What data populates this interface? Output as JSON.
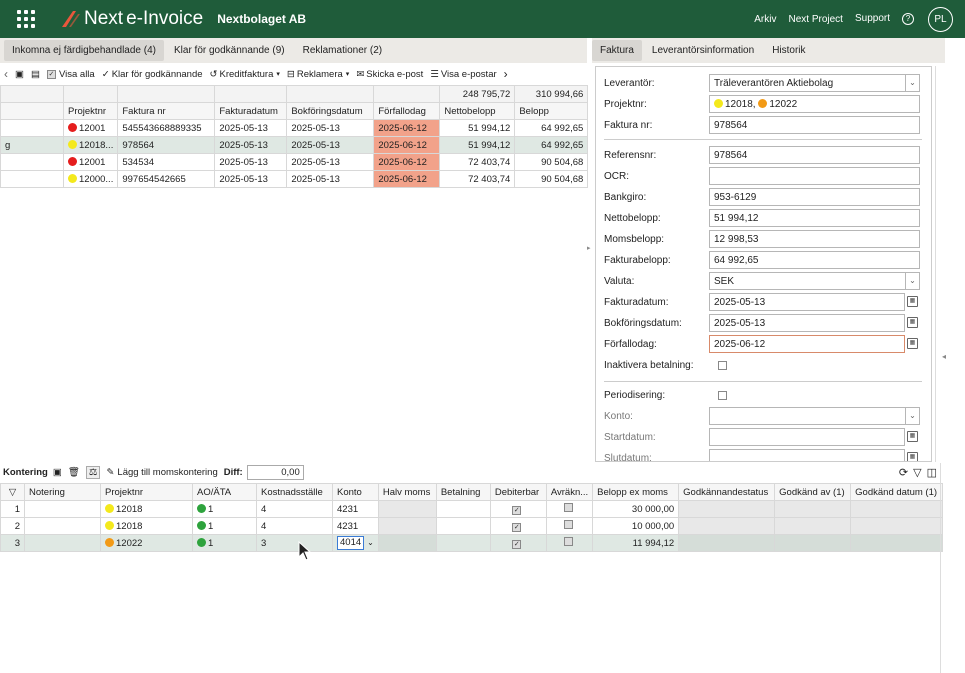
{
  "header": {
    "brand_name": "Next",
    "brand_product": "e-Invoice",
    "company": "Nextbolaget AB",
    "nav": [
      "Arkiv",
      "Next Project",
      "Support"
    ],
    "avatar": "PL"
  },
  "left_tabs": [
    "Inkomna ej färdigbehandlade (4)",
    "Klar för godkännande (9)",
    "Reklamationer (2)"
  ],
  "toolbar": {
    "visa_alla": "Visa alla",
    "klar": "Klar för godkännande",
    "kredit": "Kreditfaktura",
    "reklamera": "Reklamera",
    "skicka": "Skicka e-post",
    "visa_epost": "Visa e-postar"
  },
  "invoice_table": {
    "totals": {
      "netto": "248 795,72",
      "belopp": "310 994,66"
    },
    "columns": [
      "Projektnr",
      "Faktura nr",
      "Fakturadatum",
      "Bokföringsdatum",
      "Förfallodag",
      "Nettobelopp",
      "Belopp"
    ],
    "rows": [
      {
        "lead": "",
        "dot": "red",
        "projekt": "12001",
        "faktura": "545543668889335",
        "fdatum": "2025-05-13",
        "bdatum": "2025-05-13",
        "forfall": "2025-06-12",
        "netto": "51 994,12",
        "belopp": "64 992,65"
      },
      {
        "lead": "g",
        "dot": "yellow",
        "projekt": "12018...",
        "faktura": "978564",
        "fdatum": "2025-05-13",
        "bdatum": "2025-05-13",
        "forfall": "2025-06-12",
        "netto": "51 994,12",
        "belopp": "64 992,65"
      },
      {
        "lead": "",
        "dot": "red",
        "projekt": "12001",
        "faktura": "534534",
        "fdatum": "2025-05-13",
        "bdatum": "2025-05-13",
        "forfall": "2025-06-12",
        "netto": "72 403,74",
        "belopp": "90 504,68"
      },
      {
        "lead": "",
        "dot": "yellow",
        "projekt": "12000...",
        "faktura": "997654542665",
        "fdatum": "2025-05-13",
        "bdatum": "2025-05-13",
        "forfall": "2025-06-12",
        "netto": "72 403,74",
        "belopp": "90 504,68"
      }
    ]
  },
  "right_tabs": [
    "Faktura",
    "Leverantörsinformation",
    "Historik"
  ],
  "form": {
    "leverantor": {
      "label": "Leverantör:",
      "value": "Träleverantören Aktiebolag"
    },
    "projektnr": {
      "label": "Projektnr:",
      "p1": "12018,",
      "p2": "12022"
    },
    "fakturanr": {
      "label": "Faktura nr:",
      "value": "978564"
    },
    "referensnr": {
      "label": "Referensnr:",
      "value": "978564"
    },
    "ocr": {
      "label": "OCR:",
      "value": ""
    },
    "bankgiro": {
      "label": "Bankgiro:",
      "value": "953-6129"
    },
    "netto": {
      "label": "Nettobelopp:",
      "value": "51 994,12"
    },
    "moms": {
      "label": "Momsbelopp:",
      "value": "12 998,53"
    },
    "faktbelopp": {
      "label": "Fakturabelopp:",
      "value": "64 992,65"
    },
    "valuta": {
      "label": "Valuta:",
      "value": "SEK"
    },
    "fakturadatum": {
      "label": "Fakturadatum:",
      "value": "2025-05-13"
    },
    "bokforing": {
      "label": "Bokföringsdatum:",
      "value": "2025-05-13"
    },
    "forfallodag": {
      "label": "Förfallodag:",
      "value": "2025-06-12"
    },
    "inaktivera": {
      "label": "Inaktivera betalning:"
    },
    "periodisering": {
      "label": "Periodisering:"
    },
    "konto": {
      "label": "Konto:"
    },
    "startdatum": {
      "label": "Startdatum:"
    },
    "slutdatum": {
      "label": "Slutdatum:"
    }
  },
  "kontering": {
    "title": "Kontering",
    "add_moms": "Lägg till momskontering",
    "diff_label": "Diff:",
    "diff_value": "0,00",
    "columns": [
      "Notering",
      "Projektnr",
      "AO/ÄTA",
      "Kostnadsställe",
      "Konto",
      "Halv moms",
      "Betalning",
      "Debiterbar",
      "Avräkn...",
      "Belopp ex moms",
      "Godkännandestatus",
      "Godkänd av (1)",
      "Godkänd datum (1)"
    ],
    "rows": [
      {
        "nr": "1",
        "dot": "yellow",
        "projekt": "12018",
        "ao": "1",
        "kst": "4",
        "konto": "4231",
        "belopp": "30 000,00"
      },
      {
        "nr": "2",
        "dot": "yellow",
        "projekt": "12018",
        "ao": "1",
        "kst": "4",
        "konto": "4231",
        "belopp": "10 000,00"
      },
      {
        "nr": "3",
        "dot": "orange",
        "projekt": "12022",
        "ao": "1",
        "kst": "3",
        "konto": "4014",
        "belopp": "11 994,12"
      }
    ]
  },
  "colors": {
    "topbar": "#1f5c3a",
    "due_highlight": "#f2a28a",
    "selected_row": "#dfe8e3"
  }
}
